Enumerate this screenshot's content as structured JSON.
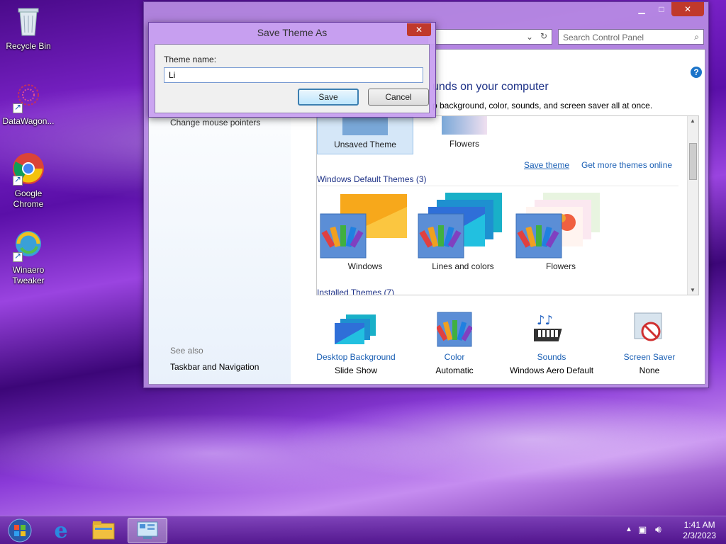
{
  "desktop": {
    "icons": [
      {
        "label": "Recycle Bin",
        "icon": "recycle-bin-icon"
      },
      {
        "label": "DataWagon...",
        "icon": "datawagon-icon"
      },
      {
        "label": "Google Chrome",
        "icon": "chrome-icon"
      },
      {
        "label": "Winaero Tweaker",
        "icon": "winaero-icon"
      }
    ]
  },
  "control_panel": {
    "search_placeholder": "Search Control Panel",
    "heading": "unds on your computer",
    "subheading": "p background, color, sounds, and screen saver all at once.",
    "sidebar": {
      "partial_link": "Change mouse pointers",
      "see_also": "See also",
      "taskbar_link": "Taskbar and Navigation"
    },
    "my_themes": [
      {
        "label": "Unsaved Theme",
        "selected": true
      },
      {
        "label": "Flowers"
      }
    ],
    "save_theme": "Save theme",
    "get_more": "Get more themes online",
    "windows_default_label": "Windows Default Themes (3)",
    "default_themes": [
      {
        "label": "Windows"
      },
      {
        "label": "Lines and colors"
      },
      {
        "label": "Flowers"
      }
    ],
    "installed_label": "Installed Themes (7)",
    "bottom": [
      {
        "title": "Desktop Background",
        "sub": "Slide Show",
        "icon": "desktop-background-icon"
      },
      {
        "title": "Color",
        "sub": "Automatic",
        "icon": "color-icon"
      },
      {
        "title": "Sounds",
        "sub": "Windows Aero Default",
        "icon": "sounds-icon"
      },
      {
        "title": "Screen Saver",
        "sub": "None",
        "icon": "screen-saver-icon"
      }
    ]
  },
  "dialog": {
    "title": "Save Theme As",
    "label": "Theme name:",
    "value": "Li",
    "save": "Save",
    "cancel": "Cancel"
  },
  "taskbar": {
    "time": "1:41 AM",
    "date": "2/3/2023"
  },
  "colors": {
    "link": "#1a5fb4",
    "heading": "#1e3287",
    "close_red": "#c0392b"
  }
}
